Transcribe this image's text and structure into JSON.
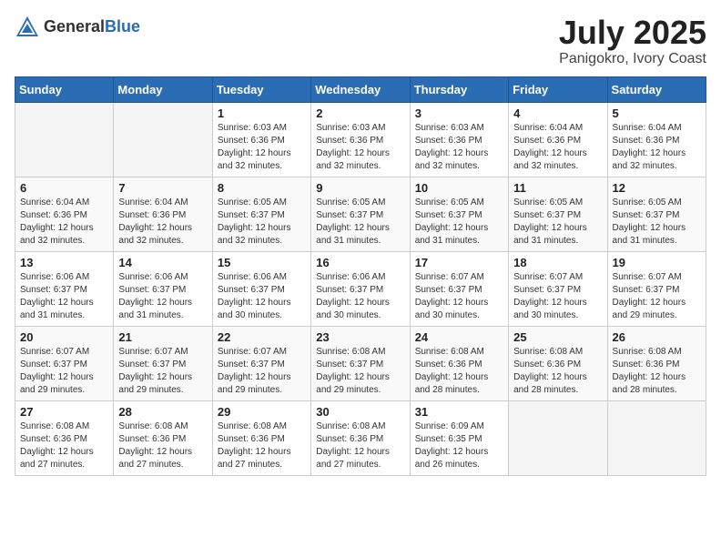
{
  "header": {
    "logo_general": "General",
    "logo_blue": "Blue",
    "month": "July 2025",
    "location": "Panigokro, Ivory Coast"
  },
  "weekdays": [
    "Sunday",
    "Monday",
    "Tuesday",
    "Wednesday",
    "Thursday",
    "Friday",
    "Saturday"
  ],
  "weeks": [
    [
      {
        "day": "",
        "detail": ""
      },
      {
        "day": "",
        "detail": ""
      },
      {
        "day": "1",
        "detail": "Sunrise: 6:03 AM\nSunset: 6:36 PM\nDaylight: 12 hours and 32 minutes."
      },
      {
        "day": "2",
        "detail": "Sunrise: 6:03 AM\nSunset: 6:36 PM\nDaylight: 12 hours and 32 minutes."
      },
      {
        "day": "3",
        "detail": "Sunrise: 6:03 AM\nSunset: 6:36 PM\nDaylight: 12 hours and 32 minutes."
      },
      {
        "day": "4",
        "detail": "Sunrise: 6:04 AM\nSunset: 6:36 PM\nDaylight: 12 hours and 32 minutes."
      },
      {
        "day": "5",
        "detail": "Sunrise: 6:04 AM\nSunset: 6:36 PM\nDaylight: 12 hours and 32 minutes."
      }
    ],
    [
      {
        "day": "6",
        "detail": "Sunrise: 6:04 AM\nSunset: 6:36 PM\nDaylight: 12 hours and 32 minutes."
      },
      {
        "day": "7",
        "detail": "Sunrise: 6:04 AM\nSunset: 6:36 PM\nDaylight: 12 hours and 32 minutes."
      },
      {
        "day": "8",
        "detail": "Sunrise: 6:05 AM\nSunset: 6:37 PM\nDaylight: 12 hours and 32 minutes."
      },
      {
        "day": "9",
        "detail": "Sunrise: 6:05 AM\nSunset: 6:37 PM\nDaylight: 12 hours and 31 minutes."
      },
      {
        "day": "10",
        "detail": "Sunrise: 6:05 AM\nSunset: 6:37 PM\nDaylight: 12 hours and 31 minutes."
      },
      {
        "day": "11",
        "detail": "Sunrise: 6:05 AM\nSunset: 6:37 PM\nDaylight: 12 hours and 31 minutes."
      },
      {
        "day": "12",
        "detail": "Sunrise: 6:05 AM\nSunset: 6:37 PM\nDaylight: 12 hours and 31 minutes."
      }
    ],
    [
      {
        "day": "13",
        "detail": "Sunrise: 6:06 AM\nSunset: 6:37 PM\nDaylight: 12 hours and 31 minutes."
      },
      {
        "day": "14",
        "detail": "Sunrise: 6:06 AM\nSunset: 6:37 PM\nDaylight: 12 hours and 31 minutes."
      },
      {
        "day": "15",
        "detail": "Sunrise: 6:06 AM\nSunset: 6:37 PM\nDaylight: 12 hours and 30 minutes."
      },
      {
        "day": "16",
        "detail": "Sunrise: 6:06 AM\nSunset: 6:37 PM\nDaylight: 12 hours and 30 minutes."
      },
      {
        "day": "17",
        "detail": "Sunrise: 6:07 AM\nSunset: 6:37 PM\nDaylight: 12 hours and 30 minutes."
      },
      {
        "day": "18",
        "detail": "Sunrise: 6:07 AM\nSunset: 6:37 PM\nDaylight: 12 hours and 30 minutes."
      },
      {
        "day": "19",
        "detail": "Sunrise: 6:07 AM\nSunset: 6:37 PM\nDaylight: 12 hours and 29 minutes."
      }
    ],
    [
      {
        "day": "20",
        "detail": "Sunrise: 6:07 AM\nSunset: 6:37 PM\nDaylight: 12 hours and 29 minutes."
      },
      {
        "day": "21",
        "detail": "Sunrise: 6:07 AM\nSunset: 6:37 PM\nDaylight: 12 hours and 29 minutes."
      },
      {
        "day": "22",
        "detail": "Sunrise: 6:07 AM\nSunset: 6:37 PM\nDaylight: 12 hours and 29 minutes."
      },
      {
        "day": "23",
        "detail": "Sunrise: 6:08 AM\nSunset: 6:37 PM\nDaylight: 12 hours and 29 minutes."
      },
      {
        "day": "24",
        "detail": "Sunrise: 6:08 AM\nSunset: 6:36 PM\nDaylight: 12 hours and 28 minutes."
      },
      {
        "day": "25",
        "detail": "Sunrise: 6:08 AM\nSunset: 6:36 PM\nDaylight: 12 hours and 28 minutes."
      },
      {
        "day": "26",
        "detail": "Sunrise: 6:08 AM\nSunset: 6:36 PM\nDaylight: 12 hours and 28 minutes."
      }
    ],
    [
      {
        "day": "27",
        "detail": "Sunrise: 6:08 AM\nSunset: 6:36 PM\nDaylight: 12 hours and 27 minutes."
      },
      {
        "day": "28",
        "detail": "Sunrise: 6:08 AM\nSunset: 6:36 PM\nDaylight: 12 hours and 27 minutes."
      },
      {
        "day": "29",
        "detail": "Sunrise: 6:08 AM\nSunset: 6:36 PM\nDaylight: 12 hours and 27 minutes."
      },
      {
        "day": "30",
        "detail": "Sunrise: 6:08 AM\nSunset: 6:36 PM\nDaylight: 12 hours and 27 minutes."
      },
      {
        "day": "31",
        "detail": "Sunrise: 6:09 AM\nSunset: 6:35 PM\nDaylight: 12 hours and 26 minutes."
      },
      {
        "day": "",
        "detail": ""
      },
      {
        "day": "",
        "detail": ""
      }
    ]
  ]
}
